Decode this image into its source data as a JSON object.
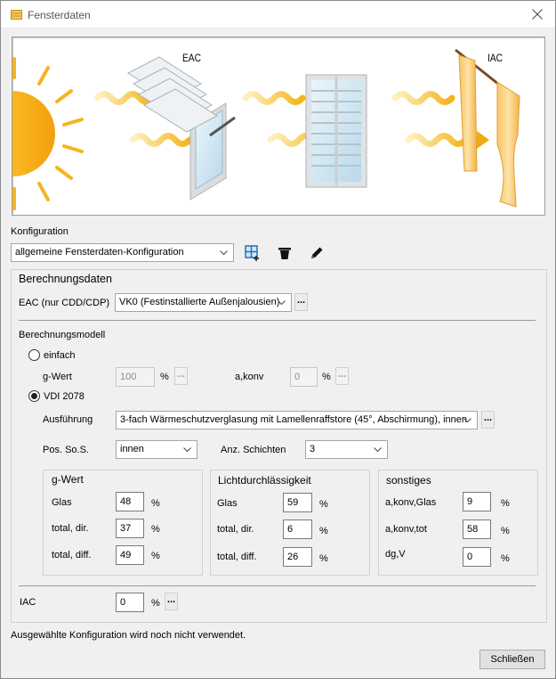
{
  "window": {
    "title": "Fensterdaten"
  },
  "illustration": {
    "eac_label": "EAC",
    "iac_label": "IAC"
  },
  "konfiguration": {
    "label": "Konfiguration",
    "selected": "allgemeine Fensterdaten-Konfiguration"
  },
  "berechnungsdaten": {
    "title": "Berechnungsdaten",
    "eac_label": "EAC (nur CDD/CDP)",
    "eac_value": "VK0 (Festinstallierte Außenjalousien)"
  },
  "berechnungsmodell": {
    "title": "Berechnungsmodell",
    "einfach_label": "einfach",
    "gwert_label": "g-Wert",
    "gwert_value": "100",
    "akonv_label": "a,konv",
    "akonv_value": "0",
    "vdi_label": "VDI 2078",
    "ausfuehrung_label": "Ausführung",
    "ausfuehrung_value": "3-fach Wärmeschutzverglasung mit Lamellenraffstore (45°, Abschirmung), innen",
    "pos_label": "Pos. So.S.",
    "pos_value": "innen",
    "schichten_label": "Anz. Schichten",
    "schichten_value": "3"
  },
  "gwert_group": {
    "title": "g-Wert",
    "rows": [
      {
        "label": "Glas",
        "value": "48"
      },
      {
        "label": "total, dir.",
        "value": "37"
      },
      {
        "label": "total, diff.",
        "value": "49"
      }
    ]
  },
  "licht_group": {
    "title": "Lichtdurchlässigkeit",
    "rows": [
      {
        "label": "Glas",
        "value": "59"
      },
      {
        "label": "total, dir.",
        "value": "6"
      },
      {
        "label": "total, diff.",
        "value": "26"
      }
    ]
  },
  "sonstiges_group": {
    "title": "sonstiges",
    "rows": [
      {
        "label": "a,konv,Glas",
        "value": "9"
      },
      {
        "label": "a,konv,tot",
        "value": "58"
      },
      {
        "label": "dg,V",
        "value": "0"
      }
    ]
  },
  "iac": {
    "label": "IAC",
    "value": "0"
  },
  "common": {
    "percent": "%",
    "dots": "..."
  },
  "status": {
    "text": "Ausgewählte Konfiguration wird noch nicht verwendet."
  },
  "buttons": {
    "close": "Schließen"
  }
}
